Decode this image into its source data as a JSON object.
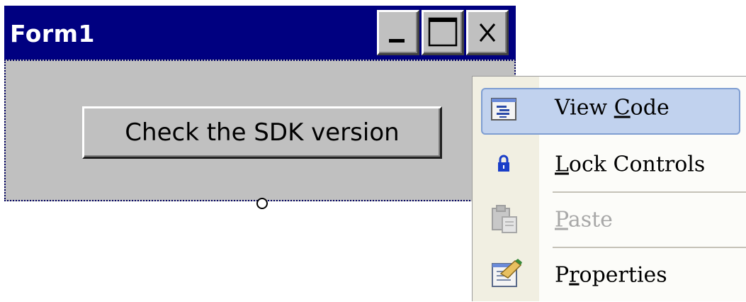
{
  "form": {
    "title": "Form1",
    "button_label": "Check the SDK version",
    "titlebar_buttons": [
      {
        "name": "minimize",
        "icon": "minimize-icon"
      },
      {
        "name": "maximize",
        "icon": "maximize-icon"
      },
      {
        "name": "close",
        "icon": "close-icon"
      }
    ]
  },
  "context_menu": {
    "items": [
      {
        "pre": "View ",
        "mnemonic": "C",
        "post": "ode",
        "icon": "view-code-icon",
        "highlighted": true,
        "enabled": true
      },
      {
        "pre": "",
        "mnemonic": "L",
        "post": "ock Controls",
        "icon": "lock-icon",
        "highlighted": false,
        "enabled": true
      },
      {
        "pre": "",
        "mnemonic": "P",
        "post": "aste",
        "icon": "paste-icon",
        "highlighted": false,
        "enabled": false
      },
      {
        "pre": "P",
        "mnemonic": "r",
        "post": "operties",
        "icon": "properties-icon",
        "highlighted": false,
        "enabled": true
      }
    ]
  },
  "colors": {
    "titlebar": "#000080",
    "face": "#c0c0c0",
    "menu_highlight": "#c1d2ee",
    "menu_highlight_border": "#7f9ed2"
  }
}
